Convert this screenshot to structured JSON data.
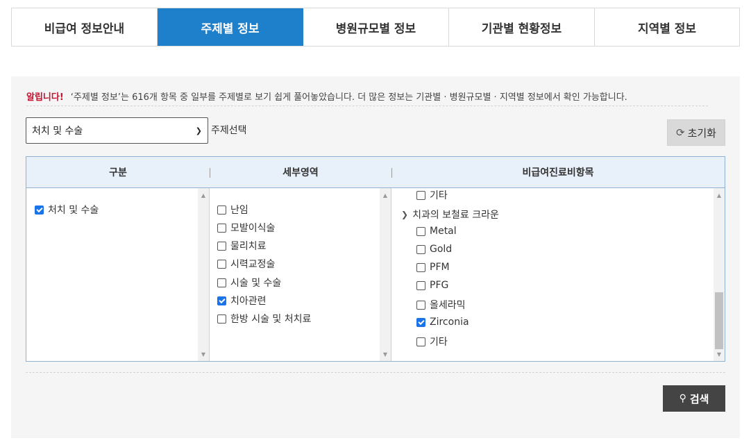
{
  "tabs": [
    {
      "label": "비급여 정보안내",
      "active": false
    },
    {
      "label": "주제별 정보",
      "active": true
    },
    {
      "label": "병원규모별 정보",
      "active": false
    },
    {
      "label": "기관별 현황정보",
      "active": false
    },
    {
      "label": "지역별 정보",
      "active": false
    }
  ],
  "notice": {
    "label": "알립니다!",
    "text": "‘주제별 정보’는 616개 항목 중 일부를 주제별로 보기 쉽게 풀어놓았습니다. 더 많은 정보는 기관별 · 병원규모별 · 지역별 정보에서 확인 가능합니다."
  },
  "topic_select": {
    "selected": "처치 및 수술",
    "caption": "주제선택"
  },
  "reset_button": {
    "label": "초기화",
    "icon": "refresh-icon"
  },
  "table": {
    "headers": [
      "구분",
      "세부영역",
      "비급여진료비항목"
    ],
    "categories": [
      {
        "label": "처치 및 수술",
        "checked": true
      }
    ],
    "subareas": [
      {
        "label": "난임",
        "checked": false
      },
      {
        "label": "모발이식술",
        "checked": false
      },
      {
        "label": "물리치료",
        "checked": false
      },
      {
        "label": "시력교정술",
        "checked": false
      },
      {
        "label": "시술 및 수술",
        "checked": false
      },
      {
        "label": "치아관련",
        "checked": true
      },
      {
        "label": "한방 시술 및 처치료",
        "checked": false
      }
    ],
    "items": {
      "prev_item": {
        "label": "기타",
        "checked": false
      },
      "group": "치과의 보철료 크라운",
      "group_items": [
        {
          "label": "Metal",
          "checked": false
        },
        {
          "label": "Gold",
          "checked": false
        },
        {
          "label": "PFM",
          "checked": false
        },
        {
          "label": "PFG",
          "checked": false
        },
        {
          "label": "올세라믹",
          "checked": false
        },
        {
          "label": "Zirconia",
          "checked": true
        },
        {
          "label": "기타",
          "checked": false
        }
      ]
    }
  },
  "search_button": {
    "label": "검색",
    "icon": "search-icon"
  }
}
